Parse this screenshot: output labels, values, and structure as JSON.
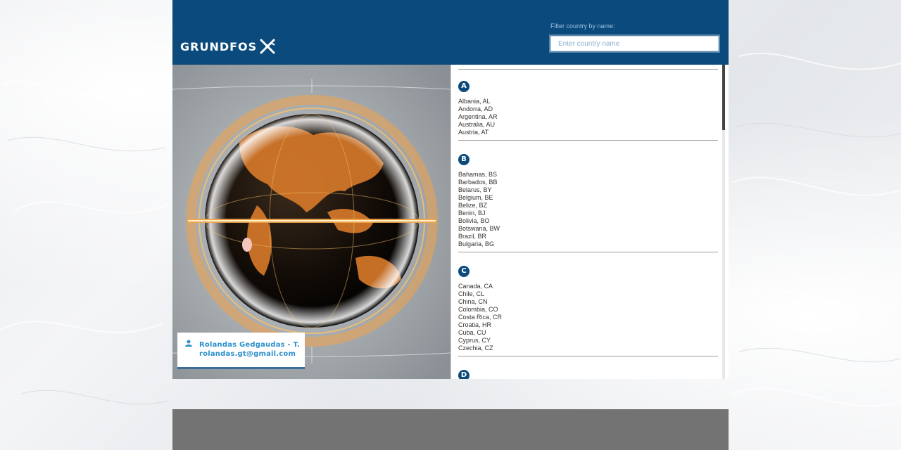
{
  "brand": {
    "name": "GRUNDFOS"
  },
  "filter": {
    "label": "Filter country by name:",
    "placeholder": "Enter country name",
    "value": ""
  },
  "user": {
    "name": "Rolandas Gedgaudas - T.",
    "email": "rolandas.gt@gmail.com"
  },
  "colors": {
    "header": "#0b4a7c",
    "accent": "#2a8fcb",
    "footer": "#737373"
  },
  "sections": [
    {
      "letter": "A",
      "items": [
        "Albania, AL",
        "Andorra, AD",
        "Argentina, AR",
        "Australia, AU",
        "Austria, AT"
      ]
    },
    {
      "letter": "B",
      "items": [
        "Bahamas, BS",
        "Barbados, BB",
        "Belarus, BY",
        "Belgium, BE",
        "Belize, BZ",
        "Benin, BJ",
        "Bolivia, BO",
        "Botswana, BW",
        "Brazil, BR",
        "Bulgaria, BG"
      ]
    },
    {
      "letter": "C",
      "items": [
        "Canada, CA",
        "Chile, CL",
        "China, CN",
        "Colombia, CO",
        "Costa Rica, CR",
        "Croatia, HR",
        "Cuba, CU",
        "Cyprus, CY",
        "Czechia, CZ"
      ]
    },
    {
      "letter": "D",
      "items": []
    }
  ]
}
